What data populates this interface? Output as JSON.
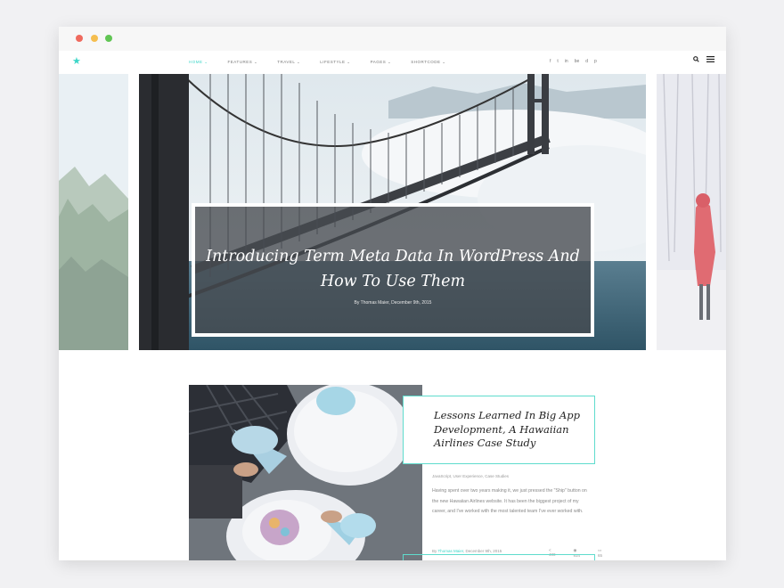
{
  "window": {
    "dots": [
      "#ef6a5e",
      "#f5be4f",
      "#61c554"
    ]
  },
  "nav": {
    "logo_icon": "star-icon",
    "accent": "#3dd6c8",
    "menu": [
      {
        "label": "Home",
        "active": true
      },
      {
        "label": "Features",
        "active": false
      },
      {
        "label": "Travel",
        "active": false
      },
      {
        "label": "Lifestyle",
        "active": false
      },
      {
        "label": "Pages",
        "active": false
      },
      {
        "label": "Shortcode",
        "active": false
      }
    ],
    "social": [
      "f",
      "t",
      "in",
      "be",
      "d",
      "p"
    ],
    "search_icon": "search-icon",
    "menu_icon": "hamburger-icon"
  },
  "hero": {
    "title": "Introducing Term Meta Data In WordPress And How To Use Them",
    "meta": "By Thomas Maier, December 9th, 2015"
  },
  "post": {
    "title": "Lessons Learned In Big App Development, A Hawaiian Airlines Case Study",
    "categories": "JavaScript, User Experience, Case Studies",
    "excerpt": "Having spent over two years making it, we just pressed the \"Ship\" button on the new Hawaiian Airlines website. It has been the biggest project of my career, and I've worked with the most talented team I've ever worked with.",
    "meta_by": "By",
    "author": "Thomas Maier",
    "date": ", December 9th, 2015",
    "shares": "400",
    "views": "934",
    "comments": "65"
  }
}
